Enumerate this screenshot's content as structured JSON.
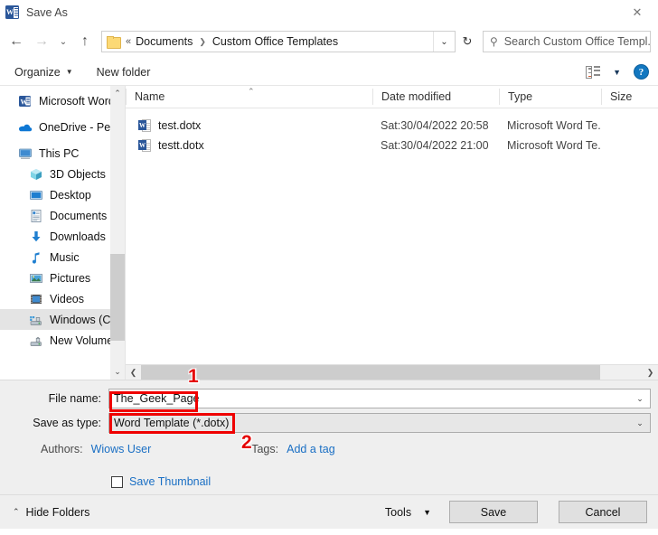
{
  "window": {
    "title": "Save As",
    "app_icon": "word-icon",
    "close_label": "✕"
  },
  "nav": {
    "back_icon": "←",
    "forward_icon": "→",
    "history_icon": "⌄",
    "up_icon": "↑",
    "breadcrumb": {
      "folder_icon": "folder-icon",
      "overflow": "«",
      "items": [
        "Documents",
        "Custom Office Templates"
      ],
      "separator": "❯",
      "dropdown_icon": "⌄"
    },
    "refresh_icon": "↻",
    "search": {
      "icon": "search-icon",
      "placeholder": "Search Custom Office Templ..."
    }
  },
  "command_bar": {
    "organize": "Organize",
    "organize_caret": "▼",
    "new_folder": "New folder",
    "view_caret": "▼",
    "help": "?"
  },
  "sidebar": {
    "items": [
      {
        "label": "Microsoft Word",
        "icon": "word-icon",
        "indent": false,
        "selected": false,
        "gap": false
      },
      {
        "label": "OneDrive - Person",
        "icon": "cloud-icon",
        "indent": false,
        "selected": false,
        "gap": true
      },
      {
        "label": "This PC",
        "icon": "monitor-icon",
        "indent": false,
        "selected": false,
        "gap": true
      },
      {
        "label": "3D Objects",
        "icon": "cube-icon",
        "indent": true,
        "selected": false,
        "gap": false
      },
      {
        "label": "Desktop",
        "icon": "desktop-icon",
        "indent": true,
        "selected": false,
        "gap": false
      },
      {
        "label": "Documents",
        "icon": "documents-icon",
        "indent": true,
        "selected": false,
        "gap": false
      },
      {
        "label": "Downloads",
        "icon": "download-arrow-icon",
        "indent": true,
        "selected": false,
        "gap": false
      },
      {
        "label": "Music",
        "icon": "music-note-icon",
        "indent": true,
        "selected": false,
        "gap": false
      },
      {
        "label": "Pictures",
        "icon": "picture-icon",
        "indent": true,
        "selected": false,
        "gap": false
      },
      {
        "label": "Videos",
        "icon": "video-icon",
        "indent": true,
        "selected": false,
        "gap": false
      },
      {
        "label": "Windows (C:)",
        "icon": "hard-drive-icon",
        "indent": true,
        "selected": true,
        "gap": false
      },
      {
        "label": "New Volume (D:)",
        "icon": "hard-drive-icon",
        "indent": true,
        "selected": false,
        "gap": false
      }
    ],
    "scroll_up_icon": "⌃",
    "scroll_down_icon": "⌄"
  },
  "filelist": {
    "columns": [
      "Name",
      "Date modified",
      "Type",
      "Size"
    ],
    "sort_indicator": "⌃",
    "rows": [
      {
        "name": "test.dotx",
        "date": "Sat:30/04/2022 20:58",
        "type": "Microsoft Word Te...",
        "size": ""
      },
      {
        "name": "testt.dotx",
        "date": "Sat:30/04/2022 21:00",
        "type": "Microsoft Word Te...",
        "size": ""
      }
    ],
    "hscroll_left_icon": "❮",
    "hscroll_right_icon": "❯"
  },
  "form": {
    "file_name_label": "File name:",
    "file_name_value": "The_Geek_Page",
    "save_as_type_label": "Save as type:",
    "save_as_type_value": "Word Template (*.dotx)",
    "dropdown_icon": "⌄",
    "authors_label": "Authors:",
    "authors_value": "Wiows User",
    "tags_label": "Tags:",
    "tags_value": "Add a tag",
    "save_thumbnail_label": "Save Thumbnail",
    "save_thumbnail_checked": false
  },
  "footer": {
    "hide_folders_caret": "⌃",
    "hide_folders": "Hide Folders",
    "tools": "Tools",
    "tools_caret": "▼",
    "save": "Save",
    "cancel": "Cancel"
  },
  "annotations": {
    "accent_color": "#ef0000",
    "markers": [
      {
        "number": "1",
        "target": "file-name-field"
      },
      {
        "number": "2",
        "target": "save-as-type-field"
      }
    ]
  }
}
